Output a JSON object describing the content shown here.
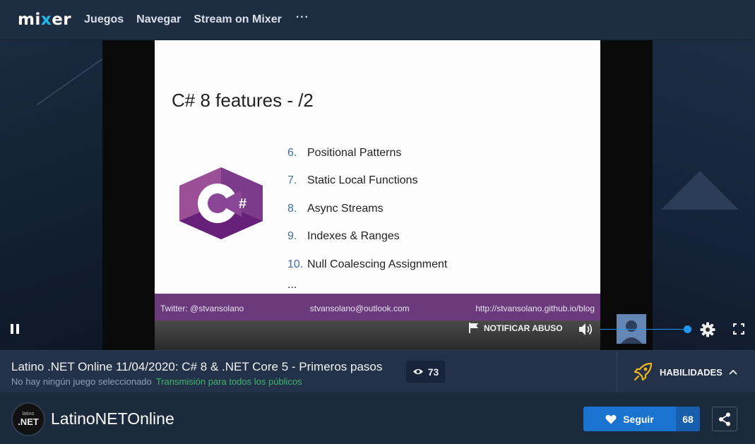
{
  "nav": {
    "logo_left": "mi",
    "logo_x": "x",
    "logo_right": "er",
    "links": [
      "Juegos",
      "Navegar",
      "Stream on Mixer"
    ],
    "more": "···"
  },
  "slide": {
    "title": "C# 8 features - /2",
    "features": [
      {
        "num": "6.",
        "text": "Positional Patterns"
      },
      {
        "num": "7.",
        "text": "Static Local Functions"
      },
      {
        "num": "8.",
        "text": "Async Streams"
      },
      {
        "num": "9.",
        "text": "Indexes & Ranges"
      },
      {
        "num": "10.",
        "text": "Null Coalescing Assignment"
      }
    ],
    "ellipsis": "...",
    "footer": {
      "twitter": "Twitter: @stvansolano",
      "email": "stvansolano@outlook.com",
      "blog": "http://stvansolano.github.io/blog"
    }
  },
  "player": {
    "report_label": "NOTIFICAR ABUSO",
    "volume_level": 1.0,
    "icons": [
      "pause-icon",
      "flag-icon",
      "volume-icon",
      "gear-icon",
      "fullscreen-icon"
    ]
  },
  "info": {
    "title": "Latino .NET Online 11/04/2020: C# 8 & .NET Core 5 - Primeros pasos",
    "game": "No hay ningún juego seleccionado",
    "audience": "Transmisión para todos los públicos",
    "viewers": "73",
    "skills_label": "HABILIDADES"
  },
  "channel": {
    "avatar_top": "latino",
    "avatar_main": ".NET",
    "name": "LatinoNETOnline",
    "follow_label": "Seguir",
    "follow_count": "68"
  },
  "colors": {
    "accent": "#1a73cf",
    "mixer_x": "#1fbaed",
    "csharp_purple": "#68217a",
    "audience_green": "#3eb56e"
  }
}
